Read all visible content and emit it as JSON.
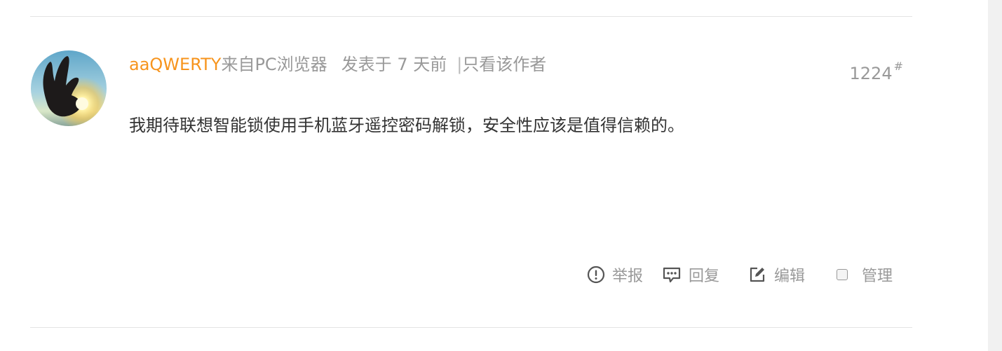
{
  "post": {
    "username": "aaQWERTY",
    "source": "来自PC浏览器",
    "posted": "发表于 7 天前",
    "separator": "|",
    "view_author_only": "只看该作者",
    "floor_number": "1224",
    "floor_mark": "#",
    "content": "我期待联想智能锁使用手机蓝牙遥控密码解锁，安全性应该是值得信赖的。",
    "avatar_icon": "user-avatar-icon"
  },
  "actions": {
    "report": {
      "label": "举报",
      "icon": "report-icon"
    },
    "reply": {
      "label": "回复",
      "icon": "reply-icon"
    },
    "edit": {
      "label": "编辑",
      "icon": "edit-icon"
    },
    "manage": {
      "label": "管理",
      "icon": "checkbox"
    }
  },
  "colors": {
    "username": "#f7941d",
    "meta": "#999999",
    "content": "#333333",
    "divider": "#e4e4e4"
  }
}
